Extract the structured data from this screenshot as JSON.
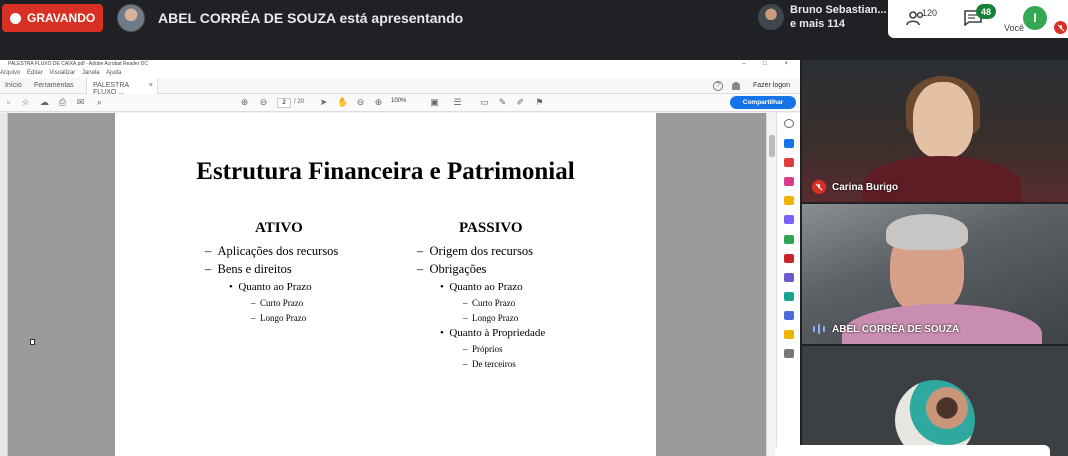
{
  "meet": {
    "recording_label": "GRAVANDO",
    "presenter_text": "ABEL CORRÊA DE SOUZA está apresentando",
    "viewers_line1": "Bruno Sebastian...",
    "viewers_line2": "e mais 114",
    "people_count": "120",
    "chat_count": "48",
    "self_initial": "I",
    "self_label": "Você",
    "colors": {
      "record": "#d93025",
      "chat_badge": "#188038",
      "self_avatar": "#34a853"
    }
  },
  "acrobat": {
    "window_title": "PALESTRA FLUXO DE CAIXA.pdf - Adobe Acrobat Reader DC",
    "window_controls": "– □ ×",
    "menu": [
      "Arquivo",
      "Editar",
      "Visualizar",
      "Janela",
      "Ajuda"
    ],
    "tabs": {
      "home": "Início",
      "tools": "Ferramentas",
      "document": "PALESTRA FLUXO ..."
    },
    "help": "?",
    "login": "Fazer logon",
    "page_current": "2",
    "page_total": "/ 20",
    "zoom": "100%",
    "share": "Compartilhar",
    "accent": "#1473e6"
  },
  "slide": {
    "title": "Estrutura Financeira e Patrimonial",
    "ativo": {
      "heading": "ATIVO",
      "items": [
        {
          "marker": "–",
          "text": "Aplicações dos recursos"
        },
        {
          "marker": "–",
          "text": "Bens e direitos"
        },
        {
          "marker": "•",
          "text": "Quanto ao Prazo"
        },
        {
          "marker": "–",
          "text": "Curto Prazo"
        },
        {
          "marker": "–",
          "text": "Longo Prazo"
        }
      ]
    },
    "passivo": {
      "heading": "PASSIVO",
      "items": [
        {
          "marker": "–",
          "text": "Origem dos recursos"
        },
        {
          "marker": "–",
          "text": "Obrigações"
        },
        {
          "marker": "•",
          "text": "Quanto ao Prazo"
        },
        {
          "marker": "–",
          "text": "Curto Prazo"
        },
        {
          "marker": "–",
          "text": "Longo Prazo"
        },
        {
          "marker": "•",
          "text": "Quanto à Propriedade"
        },
        {
          "marker": "–",
          "text": "Próprios"
        },
        {
          "marker": "–",
          "text": "De terceiros"
        }
      ]
    }
  },
  "participants": [
    {
      "name": "Carina Burigo",
      "status": "muted"
    },
    {
      "name": "ABEL CORRÊA DE SOUZA",
      "status": "speaking"
    }
  ]
}
